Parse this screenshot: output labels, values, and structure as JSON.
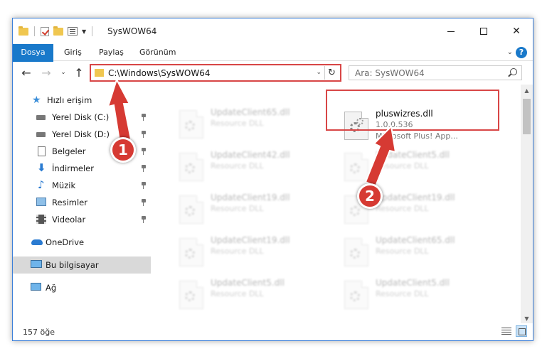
{
  "window": {
    "title": "SysWOW64"
  },
  "ribbon": {
    "tabs": [
      "Dosya",
      "Giriş",
      "Paylaş",
      "Görünüm"
    ],
    "help": "?"
  },
  "nav": {
    "address": "C:\\Windows\\SysWOW64",
    "search_placeholder": "Ara: SysWOW64"
  },
  "sidebar": {
    "items": [
      {
        "label": "Hızlı erişim",
        "icon": "star-icon"
      },
      {
        "label": "Yerel Disk (C:)",
        "icon": "drive-icon"
      },
      {
        "label": "Yerel Disk (D:)",
        "icon": "drive-icon"
      },
      {
        "label": "Belgeler",
        "icon": "document-icon"
      },
      {
        "label": "İndirmeler",
        "icon": "download-icon"
      },
      {
        "label": "Müzik",
        "icon": "music-icon"
      },
      {
        "label": "Resimler",
        "icon": "pictures-icon"
      },
      {
        "label": "Videolar",
        "icon": "video-icon"
      },
      {
        "label": "OneDrive",
        "icon": "cloud-icon"
      },
      {
        "label": "Bu bilgisayar",
        "icon": "computer-icon"
      },
      {
        "label": "Ağ",
        "icon": "network-icon"
      }
    ]
  },
  "files": {
    "featured": {
      "name": "pluswizres.dll",
      "version": "1.0.0.536",
      "description": "Microsoft Plus! App..."
    },
    "left": [
      {
        "name": "UpdateClient65.dll",
        "type": "Resource DLL"
      },
      {
        "name": "UpdateClient42.dll",
        "type": "Resource DLL"
      },
      {
        "name": "UpdateClient19.dll",
        "type": "Resource DLL"
      },
      {
        "name": "UpdateClient19.dll",
        "type": "Resource DLL"
      },
      {
        "name": "UpdateClient5.dll",
        "type": "Resource DLL"
      }
    ],
    "right": [
      {
        "name": "UpdateClient5.dll",
        "type": "Resource DLL"
      },
      {
        "name": "UpdateClient19.dll",
        "type": "Resource DLL"
      },
      {
        "name": "UpdateClient65.dll",
        "type": "Resource DLL"
      },
      {
        "name": "UpdateClient5.dll",
        "type": "Resource DLL"
      }
    ]
  },
  "status": {
    "count": "157 öğe"
  },
  "annotations": {
    "badge1": "1",
    "badge2": "2",
    "color": "#d63a33"
  }
}
